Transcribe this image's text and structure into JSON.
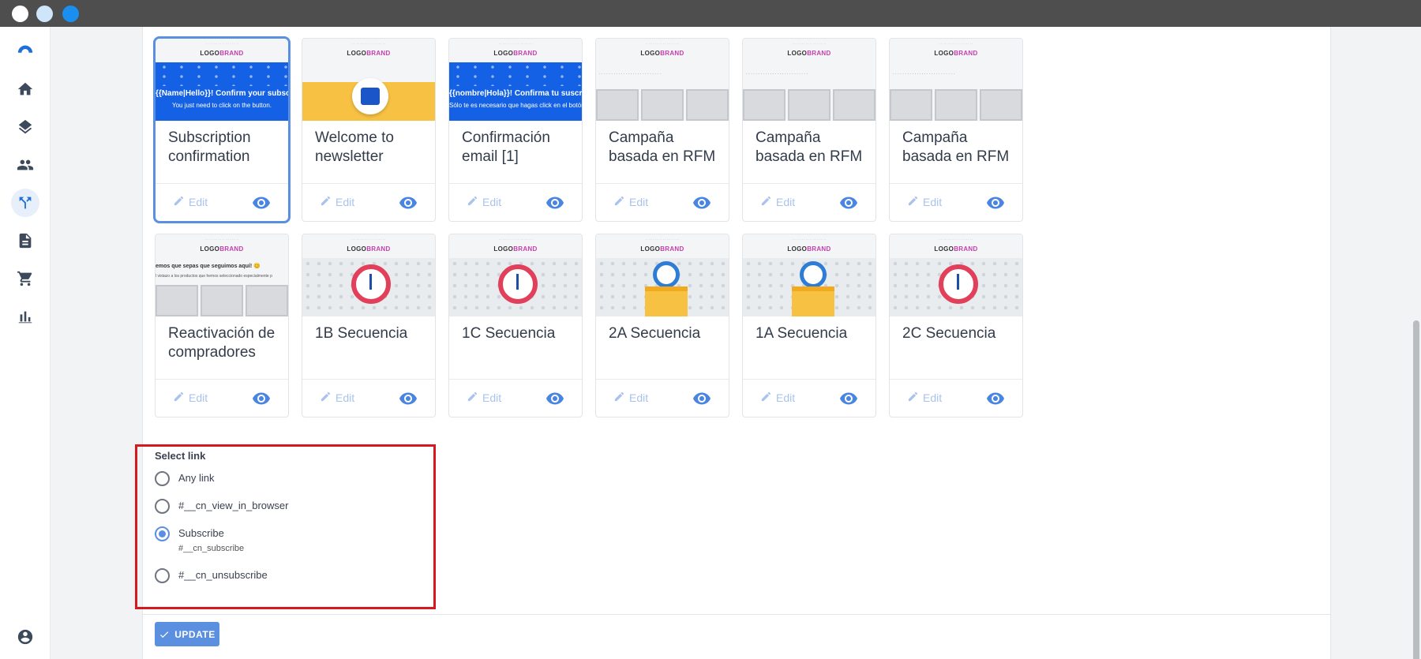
{
  "window": {
    "controls": [
      "close",
      "minimize",
      "maximize"
    ]
  },
  "sidebar": {
    "items": [
      {
        "name": "logo-icon"
      },
      {
        "name": "home-icon"
      },
      {
        "name": "layers-icon"
      },
      {
        "name": "contacts-icon"
      },
      {
        "name": "automation-icon",
        "active": true
      },
      {
        "name": "document-icon"
      },
      {
        "name": "cart-icon"
      },
      {
        "name": "reports-icon"
      },
      {
        "name": "account-icon"
      }
    ]
  },
  "templates": [
    {
      "title": "Subscription confirmation",
      "selected": true,
      "thumb": "confirm",
      "thumb_heading": "{{Name|Hello}}! Confirm your subscription",
      "thumb_sub": "You just need to click on the button."
    },
    {
      "title": "Welcome to newsletter",
      "thumb": "welcome"
    },
    {
      "title": "Confirmación email [1]",
      "thumb": "confirm",
      "thumb_heading": "{{nombre|Hola}}! Confirma tu suscripción",
      "thumb_sub": "Sólo te es necesario que hagas click en el botón."
    },
    {
      "title": "Campaña basada en RFM",
      "thumb": "rfm"
    },
    {
      "title": "Campaña basada en RFM",
      "thumb": "rfm"
    },
    {
      "title": "Campaña basada en RFM",
      "thumb": "rfm"
    },
    {
      "title": "Reactivación de compradores",
      "thumb": "reac",
      "thumb_heading": "emos que sepas que seguimos aquí! 😊",
      "thumb_sub": "l vistazo a los productos que hemos seleccionado especialmente p"
    },
    {
      "title": "1B Secuencia",
      "thumb": "clock"
    },
    {
      "title": "1C Secuencia",
      "thumb": "clock"
    },
    {
      "title": "2A Secuencia",
      "thumb": "box"
    },
    {
      "title": "1A Secuencia",
      "thumb": "box"
    },
    {
      "title": "2C Secuencia",
      "thumb": "clock"
    }
  ],
  "card_actions": {
    "edit_label": "Edit"
  },
  "thumb_logo": {
    "logo": "LOGO",
    "brand": "BRAND"
  },
  "select_link": {
    "label": "Select link",
    "options": [
      {
        "label": "Any link",
        "sub": "",
        "checked": false
      },
      {
        "label": "#__cn_view_in_browser",
        "sub": "",
        "checked": false
      },
      {
        "label": "Subscribe",
        "sub": "#__cn_subscribe",
        "checked": true
      },
      {
        "label": "#__cn_unsubscribe",
        "sub": "",
        "checked": false
      }
    ]
  },
  "footer": {
    "update_label": "UPDATE"
  },
  "colors": {
    "accent": "#5b8fe0",
    "highlight_border": "#d6181f",
    "titlebar": "#4e4e4e"
  }
}
